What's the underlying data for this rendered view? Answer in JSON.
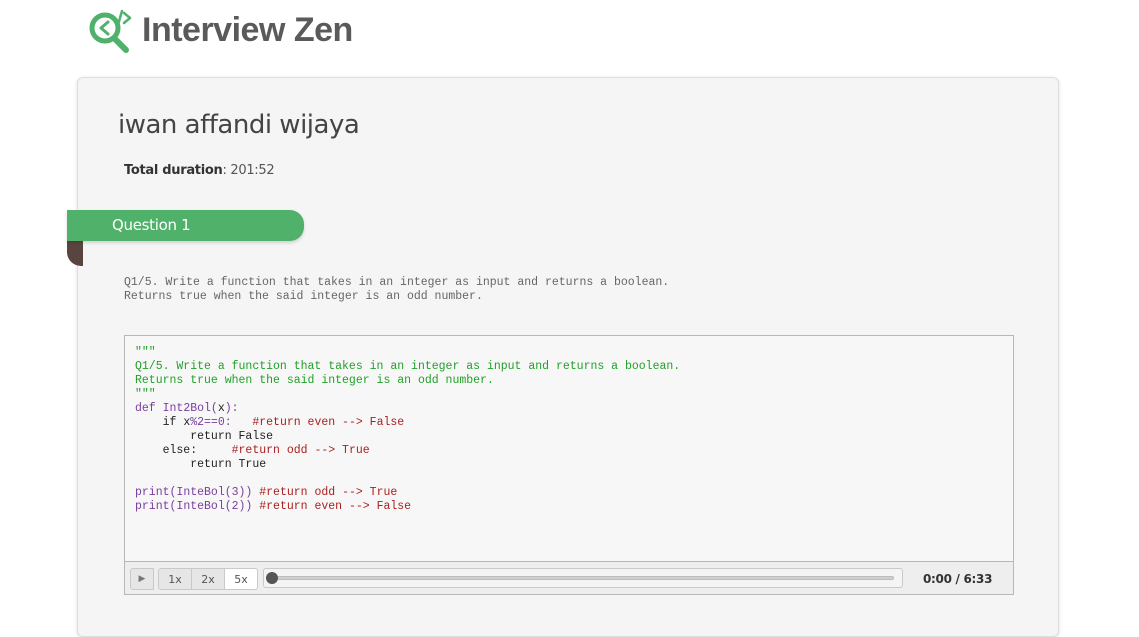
{
  "brand": {
    "name": "Interview Zen",
    "logo_icon": "magnifier-code-icon",
    "colors": {
      "green": "#4fb16a",
      "text": "#5a5a5a"
    }
  },
  "candidate": {
    "name": "iwan affandi wijaya",
    "duration_label": "Total duration",
    "duration_sep": ":",
    "duration_value": " 201:52"
  },
  "question": {
    "label": "Question 1",
    "text": "Q1/5. Write a function that takes in an integer as input and returns a boolean.\nReturns true when the said integer is an odd number."
  },
  "editor": {
    "lines": [
      [
        {
          "t": "\"\"\"",
          "c": "comment"
        }
      ],
      [
        {
          "t": "Q1/5. Write a function that takes in an integer as input and returns a boolean.",
          "c": "comment"
        }
      ],
      [
        {
          "t": "Returns true when the said integer is an odd number.",
          "c": "comment"
        }
      ],
      [
        {
          "t": "\"\"\"",
          "c": "comment"
        }
      ],
      [
        {
          "t": "def ",
          "c": "kw"
        },
        {
          "t": "Int2Bol(",
          "c": "kw"
        },
        {
          "t": "x",
          "c": "plain"
        },
        {
          "t": "):",
          "c": "kw"
        }
      ],
      [
        {
          "t": "    if ",
          "c": "plain"
        },
        {
          "t": "x",
          "c": "plain"
        },
        {
          "t": "%",
          "c": "kw"
        },
        {
          "t": "2",
          "c": "kw"
        },
        {
          "t": "==0:   ",
          "c": "kw"
        },
        {
          "t": "#return even --> False",
          "c": "pound"
        }
      ],
      [
        {
          "t": "        return False",
          "c": "plain"
        }
      ],
      [
        {
          "t": "    else:     ",
          "c": "plain"
        },
        {
          "t": "#return odd --> True",
          "c": "pound"
        }
      ],
      [
        {
          "t": "        return True",
          "c": "plain"
        }
      ],
      [
        {
          "t": "",
          "c": "plain"
        }
      ],
      [
        {
          "t": "print(",
          "c": "kw"
        },
        {
          "t": "InteBol(3)) ",
          "c": "kw"
        },
        {
          "t": "#return odd --> True",
          "c": "pound"
        }
      ],
      [
        {
          "t": "print(",
          "c": "kw"
        },
        {
          "t": "InteBol(2)) ",
          "c": "kw"
        },
        {
          "t": "#return even --> False",
          "c": "pound"
        }
      ]
    ]
  },
  "player": {
    "play_icon": "play-icon",
    "play_glyph": "▶",
    "speeds": [
      "1x",
      "2x",
      "5x"
    ],
    "selected_speed": "5x",
    "progress": 0.0,
    "time": "0:00 / 6:33"
  }
}
